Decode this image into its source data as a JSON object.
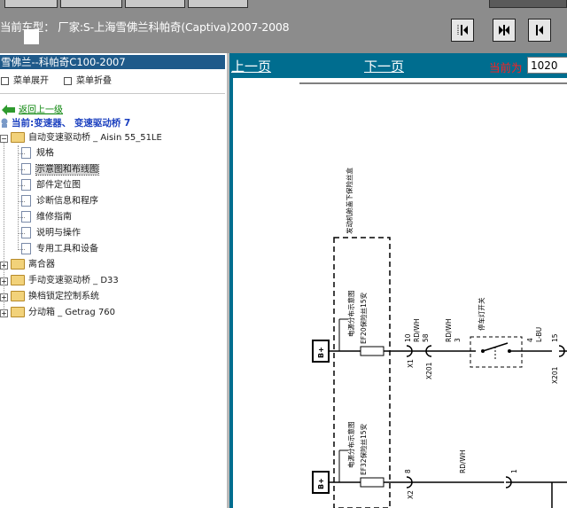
{
  "header": {
    "car_model_label": "当前车型：",
    "car_model_value": "厂家:S-上海雪佛兰科帕奇(Captiva)2007-2008",
    "buttons": [
      "first-page",
      "prev-page",
      "next-page"
    ]
  },
  "sidebar": {
    "title": "雪佛兰--科帕奇C100-2007",
    "menu_expand": "菜单展开",
    "menu_collapse": "菜单折叠",
    "back_link": "返回上一级",
    "current": "当前:变速器、 变速驱动桥 7",
    "tree": [
      {
        "label": "自动变速驱动桥 _ Aisin 55_51LE",
        "type": "folder",
        "expanded": true,
        "children": [
          "规格",
          "示意图和布线图",
          "部件定位图",
          "诊断信息和程序",
          "维修指南",
          "说明与操作",
          "专用工具和设备"
        ],
        "selected_child": "示意图和布线图"
      },
      {
        "label": "离合器",
        "type": "folder"
      },
      {
        "label": "手动变速驱动桥 _ D33",
        "type": "folder"
      },
      {
        "label": "换档锁定控制系统",
        "type": "folder"
      },
      {
        "label": "分动箱 _ Getrag 760",
        "type": "folder"
      }
    ]
  },
  "viewer": {
    "prev_label": "上一页",
    "next_label": "下一页",
    "current_label": "当前为",
    "page_value": "1020"
  },
  "diagram": {
    "fuse_box": "发动机舱盖下保险丝盒",
    "power_dist_1": "电源分布示意图",
    "fuse_1": "EF20保险丝15安",
    "wire_1_pin": "10",
    "wire_1_color": "RD/WH",
    "wire_1_num": "58",
    "connector_1": "X1",
    "connector_x201": "X201",
    "wire_2_color": "RD/WH",
    "wire_2_num": "3",
    "switch_label": "停车灯开关",
    "wire_3_pin": "4",
    "wire_3_color": "L-BU",
    "wire_3_num": "15",
    "connector_x201b": "X201",
    "power_dist_2": "电源分布示意图",
    "fuse_2": "EF32保险丝15安",
    "wire_4_pin": "8",
    "connector_2": "X2",
    "wire_4_color": "RD/WH",
    "wire_5_pin": "1",
    "bplus": "B+"
  }
}
